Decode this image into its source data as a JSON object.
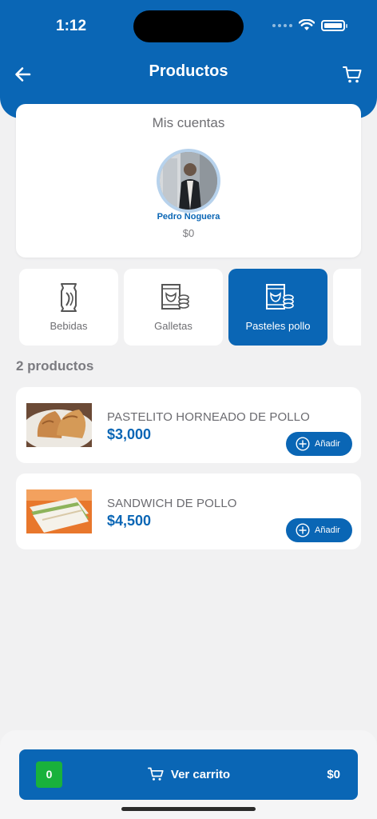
{
  "status_bar": {
    "time": "1:12"
  },
  "header": {
    "title": "Productos",
    "back_icon": "arrow-left-icon",
    "cart_icon": "cart-icon"
  },
  "account": {
    "title": "Mis cuentas",
    "user_name": "Pedro Noguera",
    "balance": "$0"
  },
  "categories": [
    {
      "label": "Bebidas",
      "icon": "can-icon",
      "active": false
    },
    {
      "label": "Galletas",
      "icon": "cookie-bag-icon",
      "active": false
    },
    {
      "label": "Pasteles pollo",
      "icon": "snack-bag-icon",
      "active": true
    }
  ],
  "products_count": "2 productos",
  "products": [
    {
      "name": "PASTELITO HORNEADO DE POLLO",
      "price": "$3,000",
      "add_label": "Añadir"
    },
    {
      "name": "SANDWICH DE POLLO",
      "price": "$4,500",
      "add_label": "Añadir"
    }
  ],
  "cart_bar": {
    "count": "0",
    "label": "Ver carrito",
    "total": "$0"
  },
  "colors": {
    "primary": "#0a66b5",
    "badge": "#19b13c",
    "background": "#f1f1f2"
  }
}
